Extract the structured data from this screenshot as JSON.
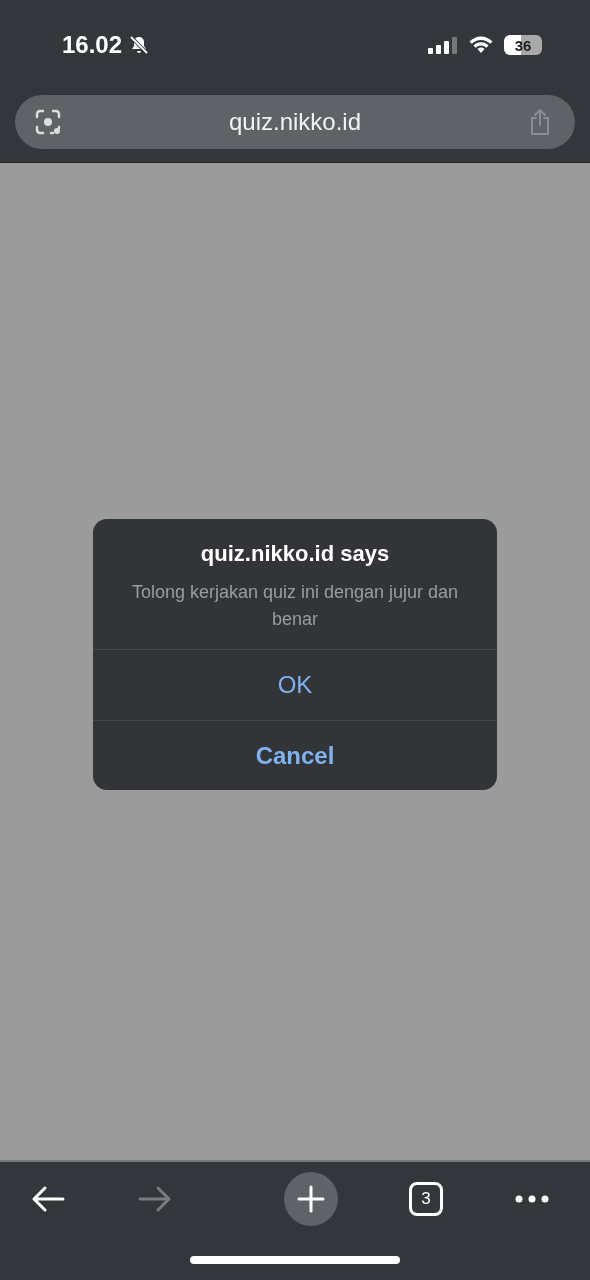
{
  "status_bar": {
    "time": "16.02",
    "battery": "36"
  },
  "address_bar": {
    "url": "quiz.nikko.id"
  },
  "dialog": {
    "title": "quiz.nikko.id says",
    "message": "Tolong kerjakan quiz ini dengan jujur dan benar",
    "buttons": [
      {
        "label": "OK",
        "kind": "default"
      },
      {
        "label": "Cancel",
        "kind": "cancel"
      }
    ]
  },
  "toolbar": {
    "back_disabled": false,
    "forward_disabled": true,
    "tab_count": "3"
  }
}
